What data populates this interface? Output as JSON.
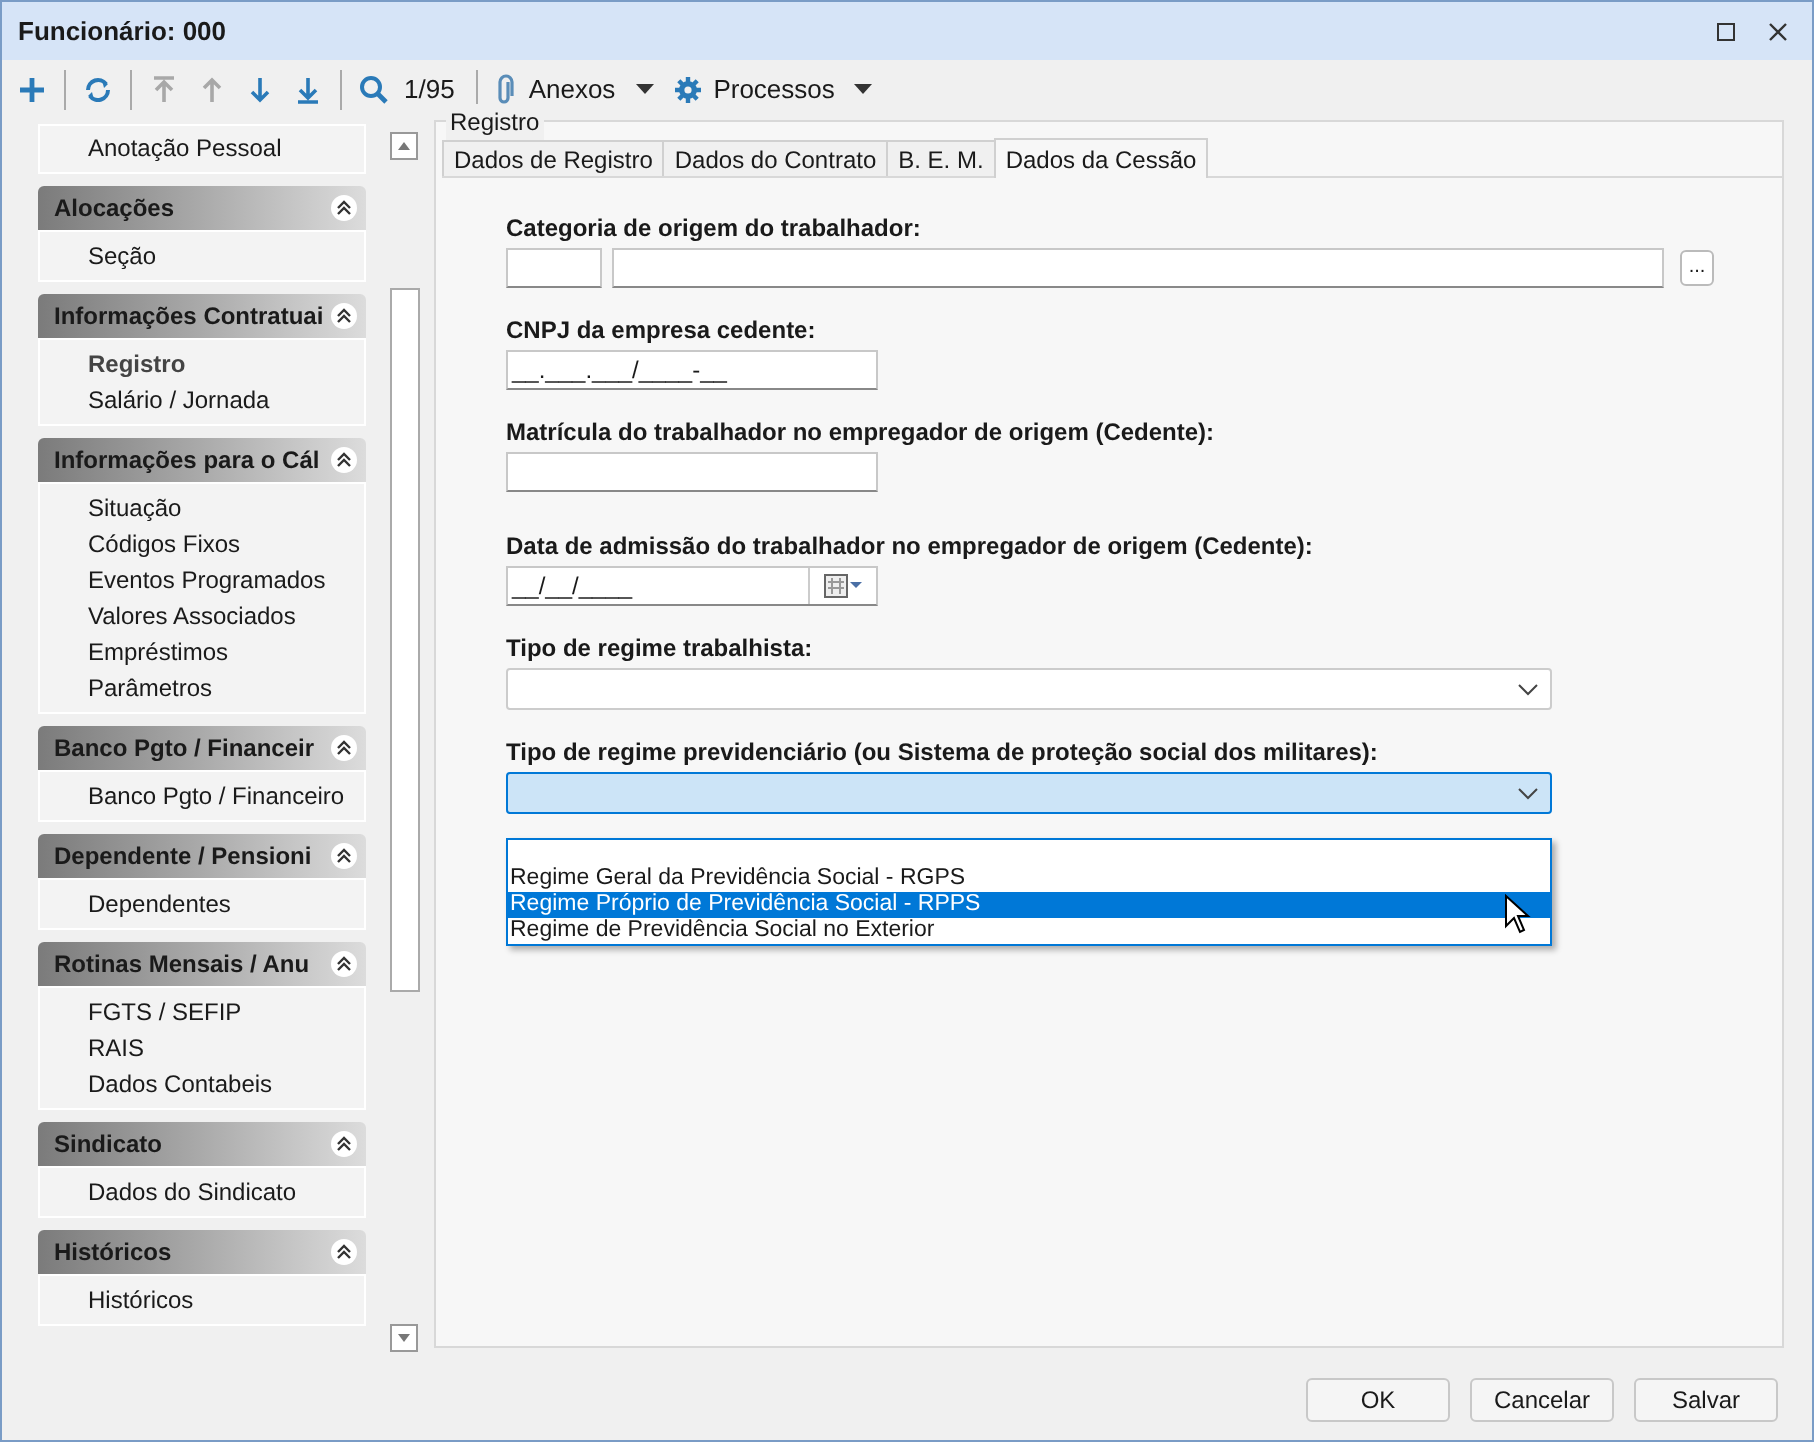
{
  "window": {
    "title": "Funcionário: 000"
  },
  "toolbar": {
    "buttons": [
      {
        "kind": "plus",
        "disabled": false
      },
      {
        "kind": "refresh",
        "disabled": false
      },
      {
        "kind": "first",
        "disabled": true
      },
      {
        "kind": "up",
        "disabled": true
      },
      {
        "kind": "down",
        "disabled": false
      },
      {
        "kind": "last",
        "disabled": false
      },
      {
        "kind": "search",
        "disabled": false
      }
    ],
    "record_counter": "1/95",
    "menus": [
      {
        "kind": "attach",
        "label": "Anexos"
      },
      {
        "kind": "gear",
        "label": "Processos"
      }
    ]
  },
  "sidebar": {
    "groups": [
      {
        "items": [
          {
            "label": "Anotação Pessoal",
            "selected": false
          }
        ]
      },
      {
        "title": "Alocações",
        "items": [
          {
            "label": "Seção",
            "selected": false
          }
        ]
      },
      {
        "title": "Informações Contratuai",
        "items": [
          {
            "label": "Registro",
            "selected": true
          },
          {
            "label": "Salário / Jornada",
            "selected": false
          }
        ]
      },
      {
        "title": "Informações para o Cál",
        "items": [
          {
            "label": "Situação",
            "selected": false
          },
          {
            "label": "Códigos Fixos",
            "selected": false
          },
          {
            "label": "Eventos Programados",
            "selected": false
          },
          {
            "label": "Valores Associados",
            "selected": false
          },
          {
            "label": "Empréstimos",
            "selected": false
          },
          {
            "label": "Parâmetros",
            "selected": false
          }
        ]
      },
      {
        "title": "Banco Pgto / Financeir",
        "items": [
          {
            "label": "Banco Pgto / Financeiro",
            "selected": false
          }
        ]
      },
      {
        "title": "Dependente / Pensioni",
        "items": [
          {
            "label": "Dependentes",
            "selected": false
          }
        ]
      },
      {
        "title": "Rotinas Mensais / Anu",
        "items": [
          {
            "label": "FGTS / SEFIP",
            "selected": false
          },
          {
            "label": "RAIS",
            "selected": false
          },
          {
            "label": "Dados Contabeis",
            "selected": false
          }
        ]
      },
      {
        "title": "Sindicato",
        "items": [
          {
            "label": "Dados do Sindicato",
            "selected": false
          }
        ]
      },
      {
        "title": "Históricos",
        "items": [
          {
            "label": "Históricos",
            "selected": false
          }
        ]
      }
    ]
  },
  "group_box": {
    "title": "Registro"
  },
  "tabs": [
    {
      "label": "Dados de Registro",
      "selected": false
    },
    {
      "label": "Dados do Contrato",
      "selected": false
    },
    {
      "label": "B. E. M.",
      "selected": false
    },
    {
      "label": "Dados da Cessão",
      "selected": true
    }
  ],
  "fields": [
    {
      "kind": "lookup",
      "label": "Categoria de origem do trabalhador:",
      "lookup_button": "..."
    },
    {
      "kind": "text",
      "label": "CNPJ da empresa cedente:",
      "value": "__.___.___/____-__"
    },
    {
      "kind": "text",
      "label": "Matrícula do trabalhador no empregador de origem (Cedente):"
    },
    {
      "kind": "date",
      "label": "Data de admissão do trabalhador no empregador de origem (Cedente):",
      "value": "__/__/____"
    },
    {
      "kind": "select",
      "label": "Tipo de regime trabalhista:",
      "expanded": false
    },
    {
      "kind": "select",
      "label": "Tipo de regime previdenciário (ou Sistema de proteção social dos militares):",
      "expanded": true,
      "options": [
        {
          "label": "Regime Geral da Previdência Social - RGPS",
          "selected": false
        },
        {
          "label": "Regime Próprio de Previdência Social - RPPS",
          "selected": true
        },
        {
          "label": "Regime de Previdência Social no Exterior",
          "selected": false
        }
      ]
    }
  ],
  "buttons": [
    "OK",
    "Cancelar",
    "Salvar"
  ]
}
